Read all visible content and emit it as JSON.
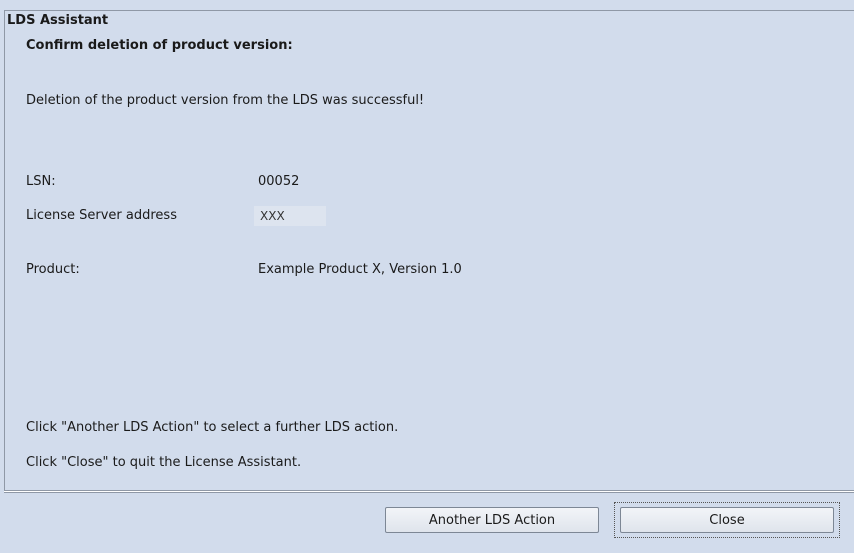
{
  "window": {
    "title": "LDS Assistant"
  },
  "content": {
    "heading": "Confirm deletion of product version:",
    "message": "Deletion of the product version from the LDS was successful!",
    "fields": [
      {
        "label": "LSN:",
        "value": "00052"
      },
      {
        "label": "License Server address",
        "value": "XXX"
      },
      {
        "label": "Product:",
        "value": "Example Product X, Version 1.0"
      }
    ],
    "hints": [
      "Click \"Another LDS Action\" to select a further LDS action.",
      "Click \"Close\" to quit the License Assistant."
    ]
  },
  "buttons": {
    "another_label": "Another LDS Action",
    "close_label": "Close"
  }
}
